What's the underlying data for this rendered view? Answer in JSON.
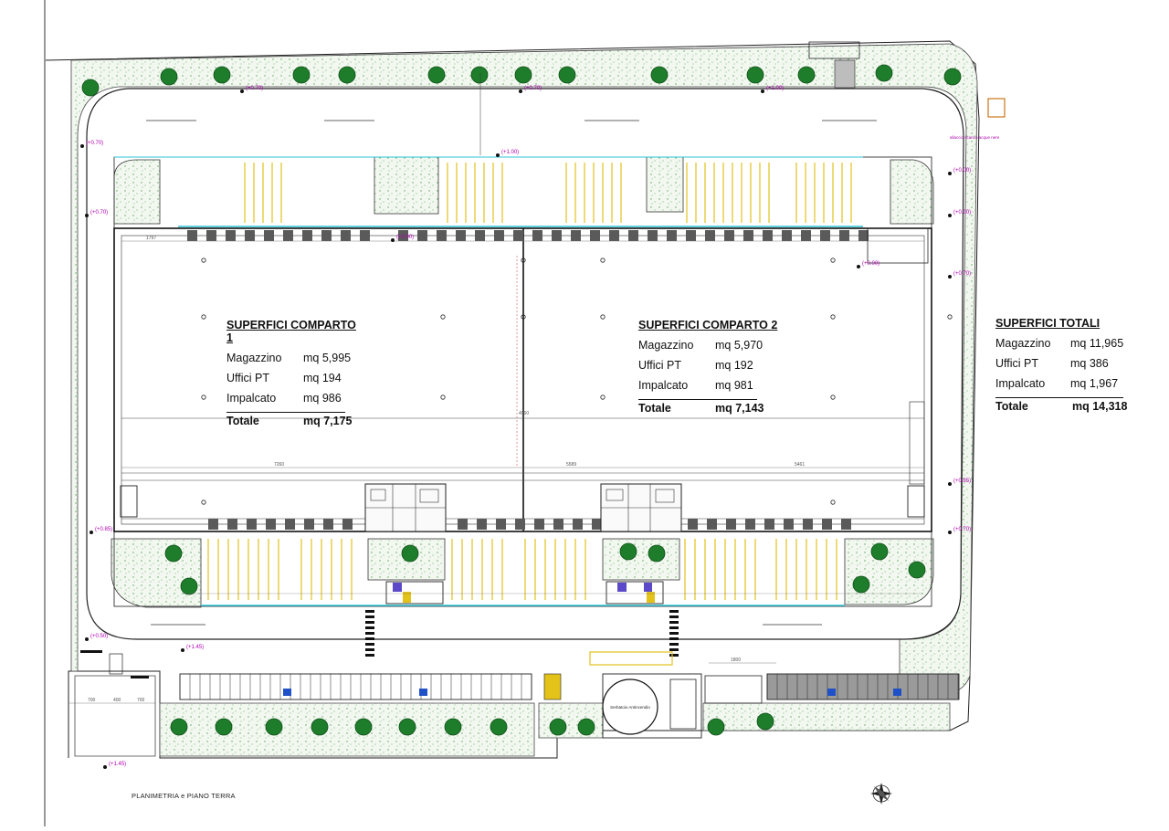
{
  "title": "PLANIMETRIA e PIANO TERRA",
  "comparto1": {
    "heading": "SUPERFICI COMPARTO 1",
    "rows": [
      {
        "label": "Magazzino",
        "value": "mq 5,995"
      },
      {
        "label": "Uffici PT",
        "value": "mq 194"
      },
      {
        "label": "Impalcato",
        "value": "mq  986"
      },
      {
        "label": "Totale",
        "value": "mq 7,175"
      }
    ]
  },
  "comparto2": {
    "heading": "SUPERFICI COMPARTO 2",
    "rows": [
      {
        "label": "Magazzino",
        "value": "mq 5,970"
      },
      {
        "label": "Uffici PT",
        "value": "mq 192"
      },
      {
        "label": "Impalcato",
        "value": "mq  981"
      },
      {
        "label": "Totale",
        "value": "mq 7,143"
      }
    ]
  },
  "totali": {
    "heading": "SUPERFICI TOTALI",
    "rows": [
      {
        "label": "Magazzino",
        "value": "mq 11,965"
      },
      {
        "label": "Uffici PT",
        "value": "mq 386"
      },
      {
        "label": "Impalcato",
        "value": "mq  1,967"
      },
      {
        "label": "Totale",
        "value": "mq 14,318"
      }
    ]
  },
  "labels": {
    "tank": "Serbatoio Antincendio",
    "canal": "allaccio scarico acque nere",
    "dim_top": "1797",
    "dim_mid": "4960",
    "dim_left": "7260",
    "dim_right": "5589",
    "dim_far": "5461",
    "dim_bottom": "1800",
    "dim_700a": "700",
    "dim_400": "400",
    "dim_700b": "700"
  },
  "elevations": [
    "(+0.70)",
    "(+0.70)",
    "(+1.00)",
    "(+0.70)",
    "(+0.70)",
    "(+0.85)",
    "(+0.00)",
    "(+0.00)",
    "(+0.00)",
    "(+0.00)",
    "(+0.70)",
    "(+0.85)",
    "(+0.70)",
    "(+1.45)",
    "(+1.45)",
    "(+0.50)",
    "(+1.00)"
  ],
  "colors": {
    "line": "#222222",
    "green_dots": "#5aa35a",
    "tree": "#1e7d2a",
    "yellow": "#e3c21a",
    "cyan": "#2cc3d6",
    "magenta": "#b000b0",
    "dock": "#5a5a5a"
  }
}
